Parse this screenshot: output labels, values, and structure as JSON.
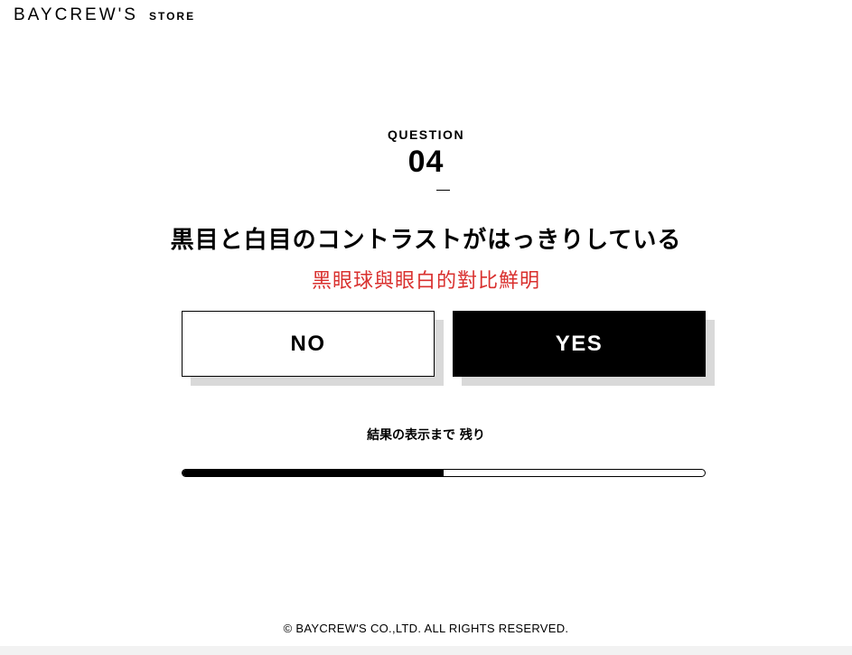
{
  "header": {
    "logo_main": "BAYCREW'S",
    "logo_sub": "STORE"
  },
  "question": {
    "label": "QUESTION",
    "number": "04",
    "text_ja": "黒目と白目のコントラストがはっきりしている",
    "text_zh": "黑眼球與眼白的對比鮮明"
  },
  "answers": {
    "no_label": "NO",
    "yes_label": "YES"
  },
  "progress": {
    "label": "結果の表示まで 残り",
    "value": 0.5
  },
  "footer": {
    "copyright": "© BAYCREW'S CO.,LTD. ALL RIGHTS RESERVED."
  },
  "colors": {
    "accent_red": "#d9302e",
    "primary": "#000000",
    "shadow": "#d9d9d9"
  }
}
